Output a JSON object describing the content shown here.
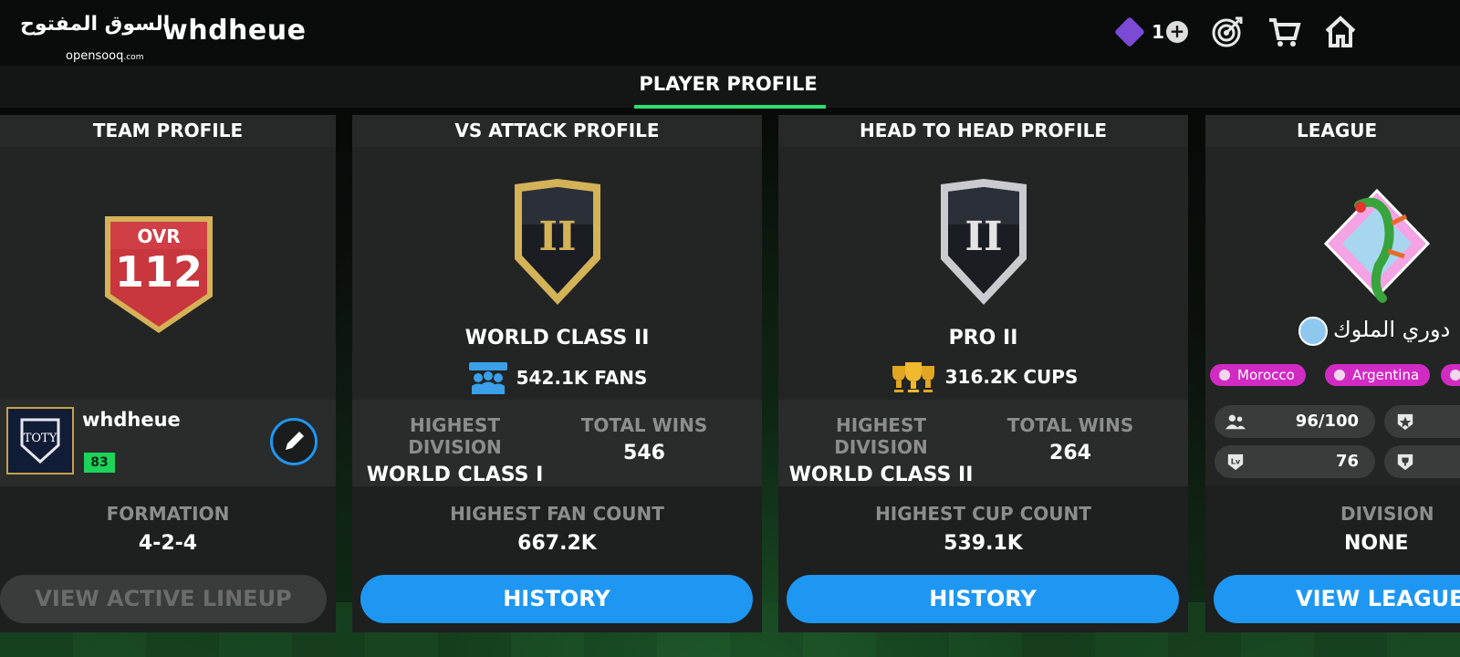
{
  "header": {
    "watermark_ar": "السوق المفتوح",
    "watermark_en": "opensooq",
    "watermark_suffix": ".com",
    "username": "whdheue",
    "ticket_count": "1",
    "icons": [
      "ticket-icon",
      "add-icon",
      "target-icon",
      "cart-icon",
      "home-icon"
    ]
  },
  "tabs": {
    "active": "PLAYER PROFILE"
  },
  "team_profile": {
    "title": "TEAM PROFILE",
    "ovr_label": "OVR",
    "ovr_value": "112",
    "player_name": "whdheue",
    "player_level": "83",
    "formation_label": "FORMATION",
    "formation_value": "4-2-4",
    "button": "VIEW ACTIVE LINEUP"
  },
  "vs_attack": {
    "title": "VS ATTACK PROFILE",
    "rank_numeral": "II",
    "rank": "WORLD CLASS II",
    "fans": "542.1K FANS",
    "highest_division_label": "HIGHEST DIVISION",
    "highest_division_value": "WORLD CLASS I",
    "total_wins_label": "TOTAL WINS",
    "total_wins_value": "546",
    "highest_count_label": "HIGHEST FAN COUNT",
    "highest_count_value": "667.2K",
    "button": "HISTORY"
  },
  "head_to_head": {
    "title": "HEAD TO HEAD PROFILE",
    "rank_numeral": "II",
    "rank": "PRO II",
    "cups": "316.2K CUPS",
    "highest_division_label": "HIGHEST DIVISION",
    "highest_division_value": "WORLD CLASS II",
    "total_wins_label": "TOTAL WINS",
    "total_wins_value": "264",
    "highest_count_label": "HIGHEST CUP COUNT",
    "highest_count_value": "539.1K",
    "button": "HISTORY"
  },
  "league_profile": {
    "title": "LEAGUE PROFILE",
    "league_name": "دوري الملوك",
    "chips": [
      "Morocco",
      "Argentina"
    ],
    "members": "96/100",
    "level": "76",
    "division_label": "DIVISION",
    "division_value": "NONE",
    "button": "VIEW LEAGUE",
    "colors": {
      "chip": "#d22bc4"
    }
  },
  "colors": {
    "accent": "#1e97f3",
    "tab_underline": "#2ee06a",
    "ovr_red": "#c8363e",
    "gold": "#d4b257",
    "silver": "#c9cbcf"
  }
}
